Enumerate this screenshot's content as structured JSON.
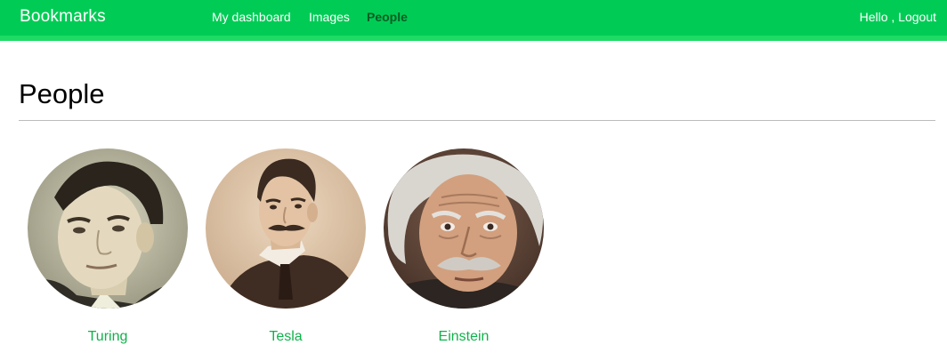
{
  "header": {
    "logo": "Bookmarks",
    "nav": [
      {
        "label": "My dashboard",
        "active": false
      },
      {
        "label": "Images",
        "active": false
      },
      {
        "label": "People",
        "active": true
      }
    ],
    "greeting": "Hello ,",
    "logout": "Logout"
  },
  "main": {
    "title": "People",
    "people": [
      {
        "name": "Turing"
      },
      {
        "name": "Tesla"
      },
      {
        "name": "Einstein"
      }
    ]
  },
  "colors": {
    "header": "#00cc55",
    "active_nav": "#0a5c24",
    "link": "#10b24b"
  }
}
